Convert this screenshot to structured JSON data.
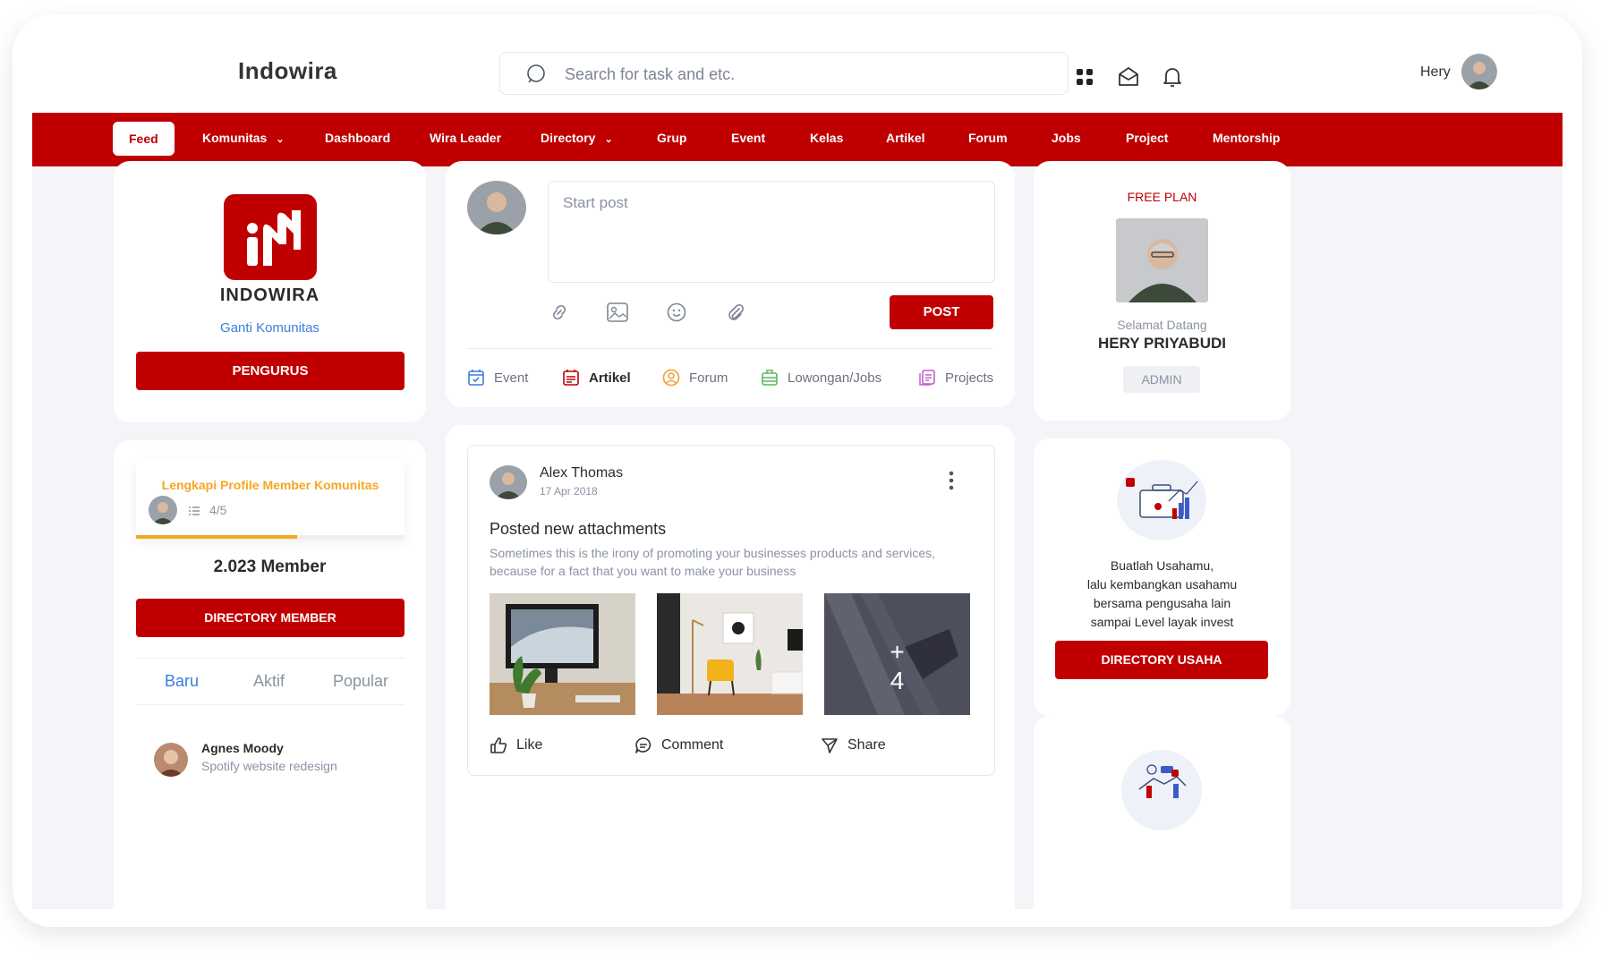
{
  "header": {
    "brand": "Indowira",
    "search_placeholder": "Search for task and etc.",
    "user_name": "Hery"
  },
  "nav": {
    "items": [
      {
        "label": "Feed"
      },
      {
        "label": "Komunitas"
      },
      {
        "label": "Dashboard"
      },
      {
        "label": "Wira Leader"
      },
      {
        "label": "Directory"
      },
      {
        "label": "Grup"
      },
      {
        "label": "Event"
      },
      {
        "label": "Kelas"
      },
      {
        "label": "Artikel"
      },
      {
        "label": "Forum"
      },
      {
        "label": "Jobs"
      },
      {
        "label": "Project"
      },
      {
        "label": "Mentorship"
      }
    ]
  },
  "community": {
    "name": "INDOWIRA",
    "change_link": "Ganti Komunitas",
    "pengurus_button": "PENGURUS"
  },
  "profile_progress": {
    "title": "Lengkapi Profile Member Komunitas",
    "progress_text": "4/5",
    "progress_fraction": 0.6,
    "member_count": "2.023 Member",
    "directory_button": "DIRECTORY MEMBER",
    "tabs": [
      "Baru",
      "Aktif",
      "Popular"
    ],
    "members": [
      {
        "name": "Agnes Moody",
        "subtitle": "Spotify website redesign"
      }
    ]
  },
  "composer": {
    "placeholder": "Start post",
    "post_button": "POST",
    "categories": [
      {
        "label": "Event",
        "icon": "calendar-icon",
        "color": "#3b7ddd"
      },
      {
        "label": "Artikel",
        "icon": "article-icon",
        "color": "#c00000"
      },
      {
        "label": "Forum",
        "icon": "forum-icon",
        "color": "#f0a030"
      },
      {
        "label": "Lowongan/Jobs",
        "icon": "jobs-icon",
        "color": "#5cb85c"
      },
      {
        "label": "Projects",
        "icon": "projects-icon",
        "color": "#c061cb"
      }
    ]
  },
  "post": {
    "author": "Alex Thomas",
    "date": "17 Apr 2018",
    "title": "Posted new attachments",
    "body": "Sometimes this is the irony of promoting your businesses products and services, because for a fact that you want to make your business",
    "more_images": "+\n4",
    "actions": {
      "like": "Like",
      "comment": "Comment",
      "share": "Share"
    }
  },
  "plan": {
    "plan_label": "FREE PLAN",
    "welcome": "Selamat Datang",
    "name": "HERY PRIYABUDI",
    "role": "ADMIN"
  },
  "business": {
    "lines": [
      "Buatlah Usahamu,",
      "lalu kembangkan usahamu",
      "bersama pengusaha lain",
      "sampai Level layak invest"
    ],
    "button": "DIRECTORY USAHA"
  },
  "colors": {
    "brand_red": "#c00000",
    "link_blue": "#3b7ddd",
    "accent_orange": "#f5a623"
  }
}
